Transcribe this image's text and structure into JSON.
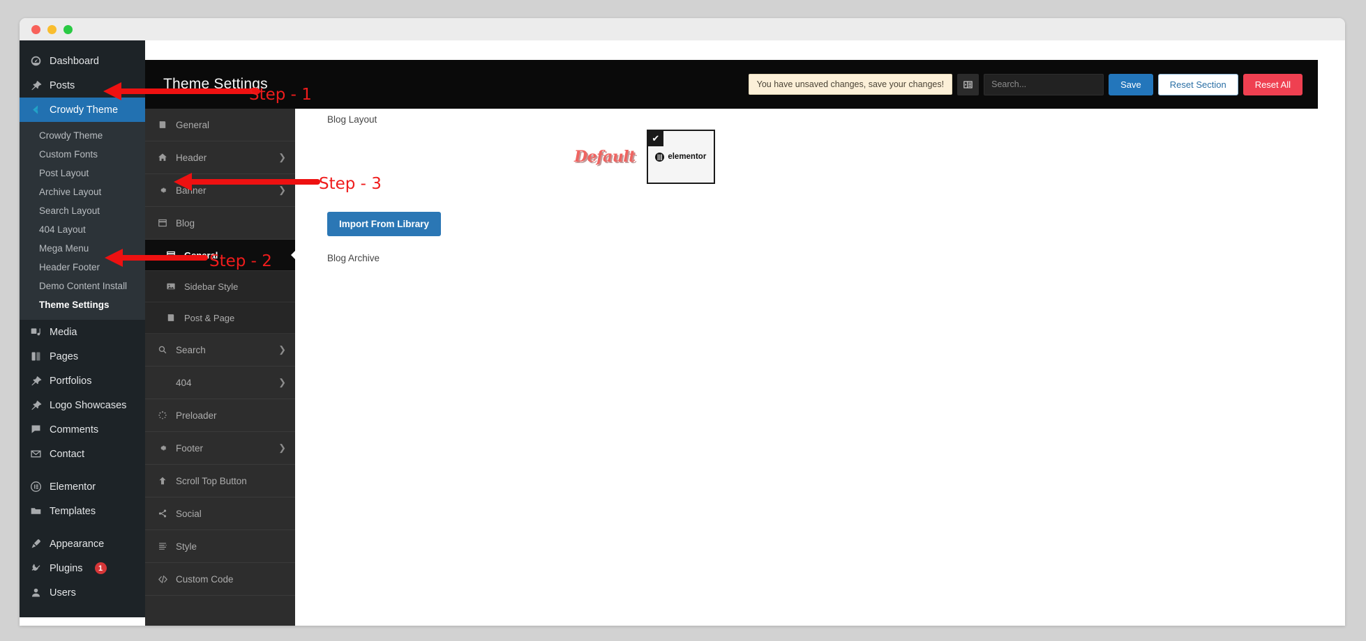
{
  "window": {
    "traffic_lights": [
      "close",
      "minimize",
      "maximize"
    ]
  },
  "wp_sidebar": {
    "items": [
      {
        "label": "Dashboard",
        "icon": "dashboard-icon",
        "state": "normal"
      },
      {
        "label": "Posts",
        "icon": "pin-icon",
        "state": "normal"
      },
      {
        "label": "Crowdy Theme",
        "icon": "crowdy-logo-icon",
        "state": "current"
      },
      {
        "label": "Media",
        "icon": "media-icon",
        "state": "normal"
      },
      {
        "label": "Pages",
        "icon": "pages-icon",
        "state": "normal"
      },
      {
        "label": "Portfolios",
        "icon": "pin-icon",
        "state": "normal"
      },
      {
        "label": "Logo Showcases",
        "icon": "pin-icon",
        "state": "normal"
      },
      {
        "label": "Comments",
        "icon": "comment-icon",
        "state": "normal"
      },
      {
        "label": "Contact",
        "icon": "envelope-icon",
        "state": "normal"
      },
      {
        "label": "Elementor",
        "icon": "elementor-icon",
        "state": "normal"
      },
      {
        "label": "Templates",
        "icon": "folder-icon",
        "state": "normal"
      },
      {
        "label": "Appearance",
        "icon": "brush-icon",
        "state": "normal"
      },
      {
        "label": "Plugins",
        "icon": "plug-icon",
        "state": "normal",
        "badge": "1"
      },
      {
        "label": "Users",
        "icon": "user-icon",
        "state": "normal"
      }
    ],
    "submenu": [
      {
        "label": "Crowdy Theme",
        "active": false
      },
      {
        "label": "Custom Fonts",
        "active": false
      },
      {
        "label": "Post Layout",
        "active": false
      },
      {
        "label": "Archive Layout",
        "active": false
      },
      {
        "label": "Search Layout",
        "active": false
      },
      {
        "label": "404 Layout",
        "active": false
      },
      {
        "label": "Mega Menu",
        "active": false
      },
      {
        "label": "Header Footer",
        "active": false
      },
      {
        "label": "Demo Content Install",
        "active": false
      },
      {
        "label": "Theme Settings",
        "active": true
      }
    ]
  },
  "panel": {
    "title": "Theme Settings",
    "unsaved_notice": "You have unsaved changes, save your changes!",
    "expand_toggle_icon": "expand-options-icon",
    "search": {
      "value": "",
      "placeholder": "Search..."
    },
    "save_label": "Save",
    "reset_section_label": "Reset Section",
    "reset_all_label": "Reset All",
    "accent_blue": "#2376bb",
    "danger_red": "#ef4051"
  },
  "panel_nav": [
    {
      "label": "General",
      "icon": "book-icon",
      "has_children": false,
      "level": 0
    },
    {
      "label": "Header",
      "icon": "home-icon",
      "has_children": true,
      "level": 0
    },
    {
      "label": "Banner",
      "icon": "gear-icon",
      "has_children": true,
      "level": 0
    },
    {
      "label": "Blog",
      "icon": "window-icon",
      "has_children": false,
      "level": 0,
      "expanded": true
    },
    {
      "label": "General",
      "icon": "window-icon",
      "has_children": false,
      "level": 1,
      "active": true
    },
    {
      "label": "Sidebar Style",
      "icon": "image-icon",
      "has_children": false,
      "level": 1
    },
    {
      "label": "Post & Page",
      "icon": "book-icon",
      "has_children": false,
      "level": 1
    },
    {
      "label": "Search",
      "icon": "search-icon",
      "has_children": true,
      "level": 0
    },
    {
      "label": "404",
      "icon": "",
      "has_children": true,
      "level": 0
    },
    {
      "label": "Preloader",
      "icon": "spinner-icon",
      "has_children": false,
      "level": 0
    },
    {
      "label": "Footer",
      "icon": "gear-icon",
      "has_children": true,
      "level": 0
    },
    {
      "label": "Scroll Top Button",
      "icon": "arrow-up-icon",
      "has_children": false,
      "level": 0
    },
    {
      "label": "Social",
      "icon": "share-icon",
      "has_children": false,
      "level": 0
    },
    {
      "label": "Style",
      "icon": "css-icon",
      "has_children": false,
      "level": 0
    },
    {
      "label": "Custom Code",
      "icon": "code-icon",
      "has_children": false,
      "level": 0
    }
  ],
  "main": {
    "blog_layout_label": "Blog Layout",
    "blog_archive_label": "Blog Archive",
    "layout_choice_name": "Default",
    "layout_thumb_text": "elementor",
    "layout_thumb_checked": true,
    "check_glyph": "✔",
    "import_button_label": "Import From Library"
  },
  "annotations": [
    {
      "label": "Step - 1",
      "target": "crowdy-theme-menu-item"
    },
    {
      "label": "Step - 2",
      "target": "theme-settings-submenu-item"
    },
    {
      "label": "Step - 3",
      "target": "blog-nav-item"
    }
  ]
}
